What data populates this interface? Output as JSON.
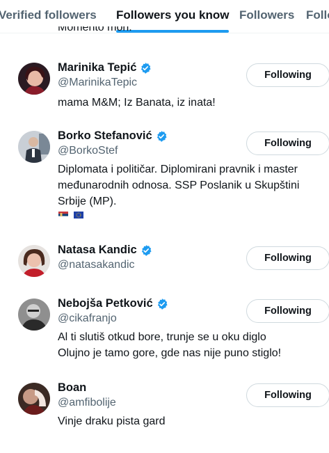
{
  "tabs": [
    {
      "label": "Verified followers",
      "active": false
    },
    {
      "label": "Followers you know",
      "active": true
    },
    {
      "label": "Followers",
      "active": false
    },
    {
      "label": "Following",
      "active": false
    }
  ],
  "cut_bio": "Momento mori.",
  "colors": {
    "accent": "#1d9bf0",
    "secondary_text": "#536471",
    "border": "#cfd9de"
  },
  "users": [
    {
      "name": "Marinika Tepić",
      "handle": "@MarinikaTepic",
      "verified": true,
      "bio_lines": [
        "mama M&M; Iz Banata, iz inata!"
      ],
      "button": "Following"
    },
    {
      "name": "Borko Stefanović",
      "handle": "@BorkoStef",
      "verified": true,
      "bio_lines": [
        "Diplomata i političar. Diplomirani pravnik i master",
        "međunarodnih odnosa. SSP Poslanik u Skupštini",
        "Srbije (MP)."
      ],
      "flags": [
        "serbia-flag",
        "eu-flag"
      ],
      "button": "Following"
    },
    {
      "name": "Natasa Kandic",
      "handle": "@natasakandic",
      "verified": true,
      "bio_lines": [],
      "button": "Following"
    },
    {
      "name": "Nebojša Petković",
      "handle": "@cikafranjo",
      "verified": true,
      "bio_lines": [
        "Al ti slutiš otkud bore, trunje se u oku diglo",
        "Olujno je tamo gore, gde nas nije puno stiglo!"
      ],
      "button": "Following"
    },
    {
      "name": "Boan",
      "handle": "@amfibolije",
      "verified": false,
      "bio_lines": [
        "Vinje draku pista gard"
      ],
      "button": "Following"
    }
  ]
}
